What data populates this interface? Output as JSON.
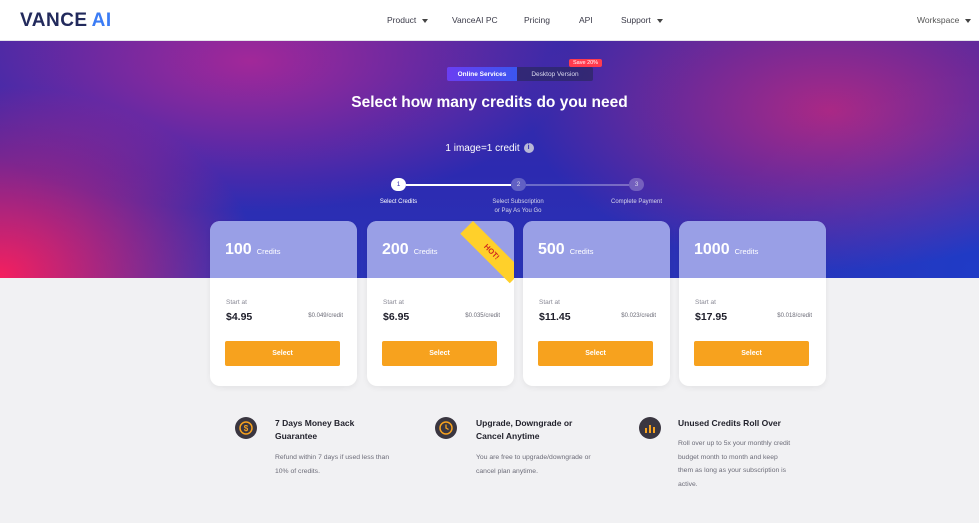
{
  "nav": {
    "logo_main": "VANCE",
    "logo_ai": "AI",
    "items": [
      {
        "label": "Product",
        "dropdown": true
      },
      {
        "label": "VanceAI PC",
        "dropdown": false
      },
      {
        "label": "Pricing",
        "dropdown": false
      },
      {
        "label": "API",
        "dropdown": false
      },
      {
        "label": "Support",
        "dropdown": true
      }
    ],
    "workspace": "Workspace"
  },
  "toggle": {
    "active": "Online Services",
    "other": "Desktop Version",
    "badge": "Save 20%"
  },
  "hero": {
    "title": "Select how many credits do you need",
    "credit_note": "1 image=1 credit",
    "info_icon": "i"
  },
  "steps": [
    {
      "number": "1",
      "label": "Select Credits"
    },
    {
      "number": "2",
      "label": "Select Subscription\nor Pay As You Go"
    },
    {
      "number": "3",
      "label": "Complete Payment"
    }
  ],
  "cards": [
    {
      "amount": "100",
      "unit": "Credits",
      "start_label": "Start at",
      "price": "$4.95",
      "per_credit": "$0.049/credit",
      "button": "Select"
    },
    {
      "amount": "200",
      "unit": "Credits",
      "start_label": "Start at",
      "price": "$6.95",
      "per_credit": "$0.035/credit",
      "button": "Select",
      "hot": "HOT!"
    },
    {
      "amount": "500",
      "unit": "Credits",
      "start_label": "Start at",
      "price": "$11.45",
      "per_credit": "$0.023/credit",
      "button": "Select"
    },
    {
      "amount": "1000",
      "unit": "Credits",
      "start_label": "Start at",
      "price": "$17.95",
      "per_credit": "$0.018/credit",
      "button": "Select"
    }
  ],
  "features": [
    {
      "icon": "money-back-icon",
      "title": "7 Days Money Back\nGuarantee",
      "desc": "Refund within 7 days if used less than\n10% of credits."
    },
    {
      "icon": "clock-icon",
      "title": "Upgrade, Downgrade or\nCancel Anytime",
      "desc": "You are free to upgrade/downgrade or\ncancel plan anytime."
    },
    {
      "icon": "bar-chart-icon",
      "title": "Unused Credits Roll Over",
      "desc": "Roll over up to 5x your monthly credit\nbudget month to month and keep\nthem as long as your subscription is\nactive."
    }
  ],
  "colors": {
    "accent_orange": "#f7a21e",
    "brand_blue": "#3b7cf5",
    "hero_purple": "#2c2ab0",
    "badge_red": "#ff3b4e"
  }
}
